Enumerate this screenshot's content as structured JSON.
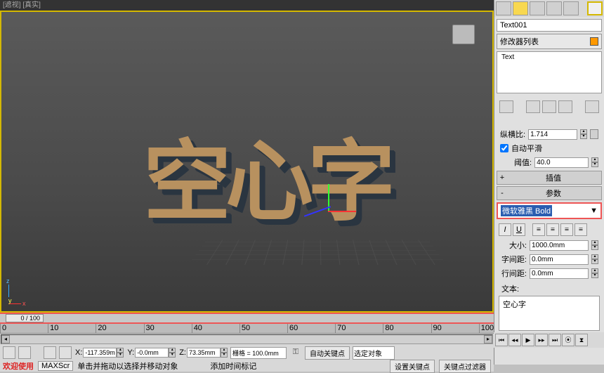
{
  "viewport": {
    "title": "[遮视] [真实]",
    "text3d": "空心字"
  },
  "panel": {
    "object_name": "Text001",
    "modifier_list_label": "修改器列表",
    "stack": [
      "Text"
    ],
    "aspect": {
      "label": "纵横比:",
      "value": "1.714"
    },
    "auto_smooth": {
      "label": "自动平滑",
      "checked": true
    },
    "threshold": {
      "label": "阈值:",
      "value": "40.0"
    },
    "rollout_interp": "插值",
    "rollout_params": "参数",
    "font": {
      "display": "微软雅黑 Bold"
    },
    "size": {
      "label": "大小:",
      "value": "1000.0mm"
    },
    "kerning": {
      "label": "字间距:",
      "value": "0.0mm"
    },
    "leading": {
      "label": "行间距:",
      "value": "0.0mm"
    },
    "text_label": "文本:",
    "text_value": "空心字"
  },
  "timeline": {
    "pos": "0 / 100",
    "ticks": [
      "0",
      "10",
      "20",
      "30",
      "40",
      "50",
      "60",
      "70",
      "80",
      "90",
      "100"
    ]
  },
  "coords": {
    "x": {
      "label": "X:",
      "value": "-117.359m"
    },
    "y": {
      "label": "Y:",
      "value": "-0.0mm"
    },
    "z": {
      "label": "Z:",
      "value": "73.35mm"
    },
    "grid": "栅格 = 100.0mm",
    "auto_key": "自动关键点",
    "sel": "选定对象",
    "set_key": "设置关键点",
    "key_filter": "关键点过滤器"
  },
  "status": {
    "welcome": "欢迎使用",
    "script": "MAXScr",
    "hint": "单击并拖动以选择并移动对象",
    "add_time": "添加时间标记"
  }
}
